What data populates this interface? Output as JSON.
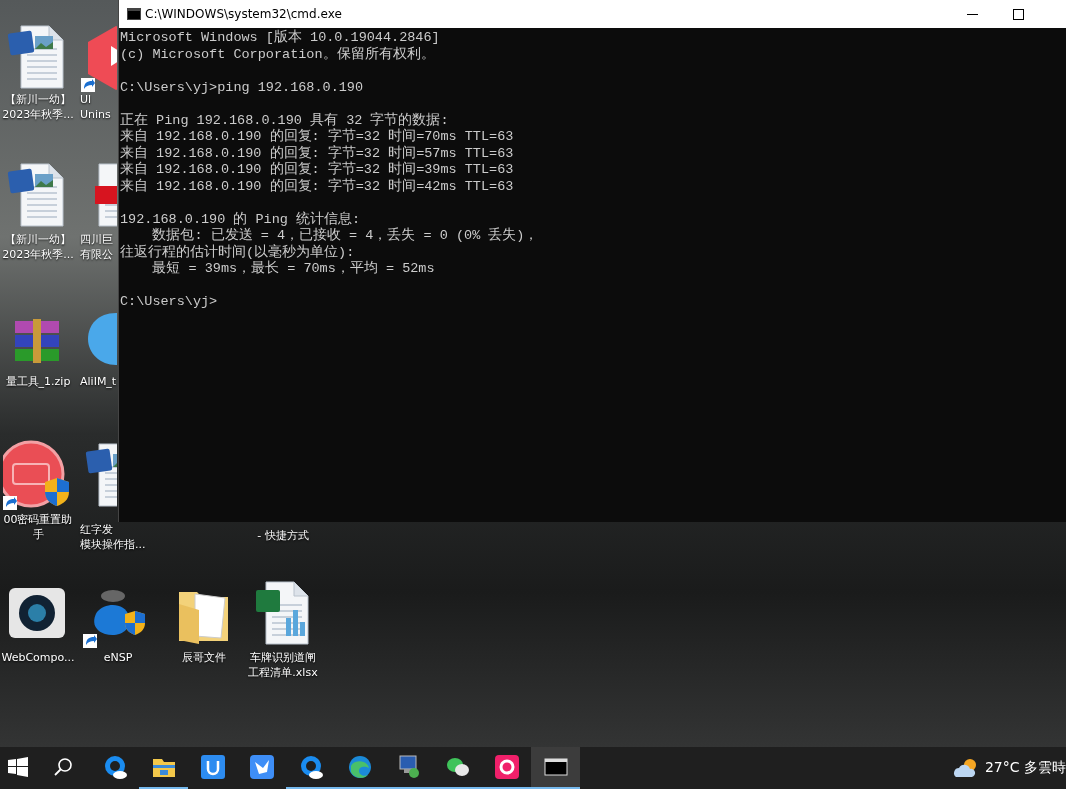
{
  "desktop_icons": [
    {
      "kind": "word",
      "shortcut": false,
      "lines": [
        "【新川一幼】",
        "2023年秋季..."
      ]
    },
    {
      "kind": "word",
      "shortcut": false,
      "lines": [
        "【新川一幼】",
        "2023年秋季..."
      ]
    },
    {
      "kind": "archive",
      "shortcut": false,
      "lines": [
        "量工具_1.zip"
      ]
    },
    {
      "kind": "record",
      "shortcut": true,
      "lines": [
        "00密码重置助",
        "手"
      ]
    },
    {
      "kind": "camera",
      "shortcut": false,
      "lines": [
        "WebCompo..."
      ]
    },
    {
      "kind": "hexagon",
      "shortcut": true,
      "lines": [
        "Ul",
        "Unins"
      ]
    },
    {
      "kind": "pdf",
      "shortcut": false,
      "lines": [
        "四川巨",
        "有限公"
      ]
    },
    {
      "kind": "bubble",
      "shortcut": false,
      "lines": [
        "AliIM_t"
      ]
    },
    {
      "kind": "word",
      "shortcut": false,
      "lines": [
        "红字发",
        "模块操作指..."
      ]
    },
    {
      "kind": "network",
      "shortcut": true,
      "lines": [
        "eNSP"
      ]
    },
    {
      "kind": "none",
      "lines": [
        "- 快捷方式"
      ]
    },
    {
      "kind": "folder",
      "shortcut": false,
      "lines": [
        "辰哥文件"
      ]
    },
    {
      "kind": "excel",
      "shortcut": false,
      "lines": [
        "车牌识别道闸",
        "工程清单.xlsx"
      ]
    }
  ],
  "window": {
    "title": "C:\\WINDOWS\\system32\\cmd.exe",
    "blocks": [
      [
        "Microsoft Windows [版本 10.0.19044.2846]",
        "(c) Microsoft Corporation。保留所有权利。"
      ],
      [
        "C:\\Users\\yj>ping 192.168.0.190"
      ],
      [
        "正在 Ping 192.168.0.190 具有 32 字节的数据:",
        "来自 192.168.0.190 的回复: 字节=32 时间=70ms TTL=63",
        "来自 192.168.0.190 的回复: 字节=32 时间=57ms TTL=63",
        "来自 192.168.0.190 的回复: 字节=32 时间=39ms TTL=63",
        "来自 192.168.0.190 的回复: 字节=32 时间=42ms TTL=63"
      ],
      [
        "192.168.0.190 的 Ping 统计信息:",
        "    数据包: 已发送 = 4，已接收 = 4，丢失 = 0 (0% 丢失)，",
        "往返行程的估计时间(以毫秒为单位):",
        "    最短 = 39ms，最长 = 70ms，平均 = 52ms"
      ],
      [
        "C:\\Users\\yj>"
      ]
    ]
  },
  "taskbar": {
    "items": [
      {
        "kind": "browser-q",
        "running": false,
        "selected": false
      },
      {
        "kind": "explorer",
        "running": true,
        "selected": false
      },
      {
        "kind": "utools",
        "running": false,
        "selected": false
      },
      {
        "kind": "bird",
        "running": false,
        "selected": false
      },
      {
        "kind": "browser-q",
        "running": true,
        "selected": false
      },
      {
        "kind": "edge",
        "running": true,
        "selected": false
      },
      {
        "kind": "remote",
        "running": true,
        "selected": false
      },
      {
        "kind": "chat",
        "running": true,
        "selected": false
      },
      {
        "kind": "pink",
        "running": true,
        "selected": false
      },
      {
        "kind": "console",
        "running": true,
        "selected": true
      }
    ],
    "weather": "27°C 多雲時"
  }
}
